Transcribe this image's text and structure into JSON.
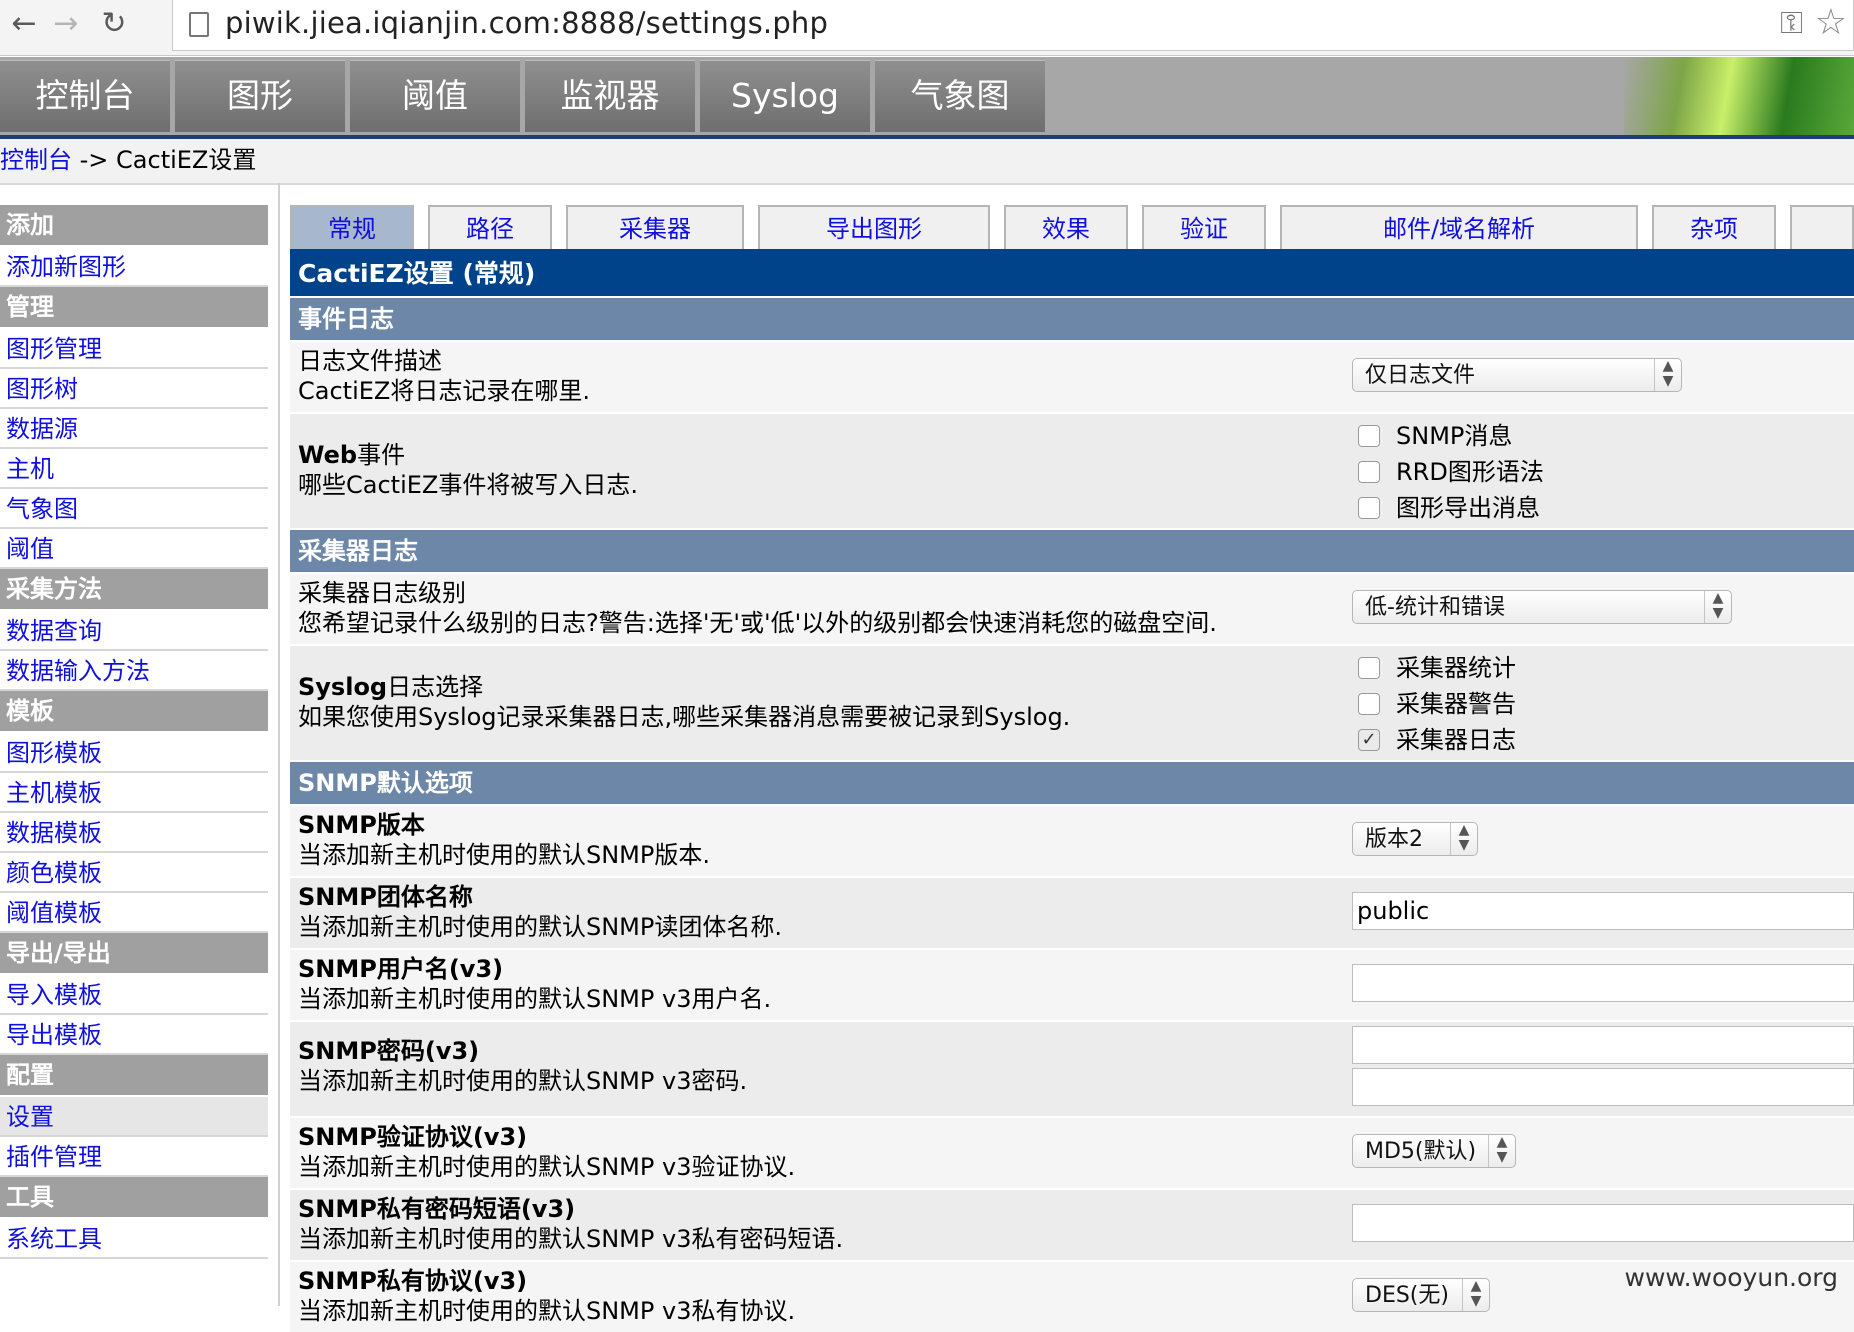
{
  "browser": {
    "back": "←",
    "forward": "→",
    "reload": "↻",
    "url": "piwik.jiea.iqianjin.com:8888/settings.php"
  },
  "topnav": [
    "控制台",
    "图形",
    "阈值",
    "监视器",
    "Syslog",
    "气象图"
  ],
  "breadcrumb": {
    "link": "控制台",
    "separator": " -> ",
    "current": "CactiEZ设置"
  },
  "sidebar": [
    {
      "type": "header",
      "label": "添加"
    },
    {
      "type": "item",
      "label": "添加新图形"
    },
    {
      "type": "header",
      "label": "管理"
    },
    {
      "type": "item",
      "label": "图形管理"
    },
    {
      "type": "item",
      "label": "图形树"
    },
    {
      "type": "item",
      "label": "数据源"
    },
    {
      "type": "item",
      "label": "主机"
    },
    {
      "type": "item",
      "label": "气象图"
    },
    {
      "type": "item",
      "label": "阈值"
    },
    {
      "type": "header",
      "label": "采集方法"
    },
    {
      "type": "item",
      "label": "数据查询"
    },
    {
      "type": "item",
      "label": "数据输入方法"
    },
    {
      "type": "header",
      "label": "模板"
    },
    {
      "type": "item",
      "label": "图形模板"
    },
    {
      "type": "item",
      "label": "主机模板"
    },
    {
      "type": "item",
      "label": "数据模板"
    },
    {
      "type": "item",
      "label": "颜色模板"
    },
    {
      "type": "item",
      "label": "阈值模板"
    },
    {
      "type": "header",
      "label": "导出/导出"
    },
    {
      "type": "item",
      "label": "导入模板"
    },
    {
      "type": "item",
      "label": "导出模板"
    },
    {
      "type": "header",
      "label": "配置"
    },
    {
      "type": "item",
      "label": "设置",
      "active": true
    },
    {
      "type": "item",
      "label": "插件管理"
    },
    {
      "type": "header",
      "label": "工具"
    },
    {
      "type": "item",
      "label": "系统工具"
    }
  ],
  "settings_tabs": [
    "常规",
    "路径",
    "采集器",
    "导出图形",
    "效果",
    "验证",
    "邮件/域名解析",
    "杂项",
    ""
  ],
  "panel_title": "CactiEZ设置 (常规)",
  "sections": {
    "event_log": "事件日志",
    "poller_log": "采集器日志",
    "snmp": "SNMP默认选项"
  },
  "rows": {
    "log_file": {
      "title": "日志文件描述",
      "desc": "CactiEZ将日志记录在哪里.",
      "value": "仅日志文件"
    },
    "web_events": {
      "title_bold": "Web",
      "title_rest": "事件",
      "desc": "哪些CactiEZ事件将被写入日志.",
      "options": [
        {
          "label": "SNMP消息",
          "checked": false
        },
        {
          "label": "RRD图形语法",
          "checked": false
        },
        {
          "label": "图形导出消息",
          "checked": false
        }
      ]
    },
    "poller_level": {
      "title": "采集器日志级别",
      "desc": "您希望记录什么级别的日志?警告:选择'无'或'低'以外的级别都会快速消耗您的磁盘空间.",
      "value": "低-统计和错误"
    },
    "syslog_select": {
      "title_bold": "Syslog",
      "title_rest": "日志选择",
      "desc": "如果您使用Syslog记录采集器日志,哪些采集器消息需要被记录到Syslog.",
      "options": [
        {
          "label": "采集器统计",
          "checked": false
        },
        {
          "label": "采集器警告",
          "checked": false
        },
        {
          "label": "采集器日志",
          "checked": true
        }
      ]
    },
    "snmp_version": {
      "title_bold": "SNMP",
      "title_rest": "版本",
      "desc": "当添加新主机时使用的默认SNMP版本.",
      "value": "版本2"
    },
    "snmp_community": {
      "title_bold": "SNMP",
      "title_rest": "团体名称",
      "desc": "当添加新主机时使用的默认SNMP读团体名称.",
      "value": "public"
    },
    "snmp_user": {
      "title_bold": "SNMP",
      "title_rest": "用户名(v3)",
      "desc": "当添加新主机时使用的默认SNMP v3用户名.",
      "value": ""
    },
    "snmp_password": {
      "title_bold": "SNMP",
      "title_rest": "密码(v3)",
      "desc": "当添加新主机时使用的默认SNMP v3密码.",
      "value": "",
      "confirm": ""
    },
    "snmp_auth": {
      "title_bold": "SNMP",
      "title_rest": "验证协议(v3)",
      "desc": "当添加新主机时使用的默认SNMP v3验证协议.",
      "value": "MD5(默认)"
    },
    "snmp_passphrase": {
      "title_bold": "SNMP",
      "title_rest": "私有密码短语(v3)",
      "desc": "当添加新主机时使用的默认SNMP v3私有密码短语.",
      "value": ""
    },
    "snmp_privproto": {
      "title_bold": "SNMP",
      "title_rest": "私有协议(v3)",
      "desc": "当添加新主机时使用的默认SNMP v3私有协议.",
      "value": "DES(无)"
    }
  },
  "watermark": "www.wooyun.org"
}
